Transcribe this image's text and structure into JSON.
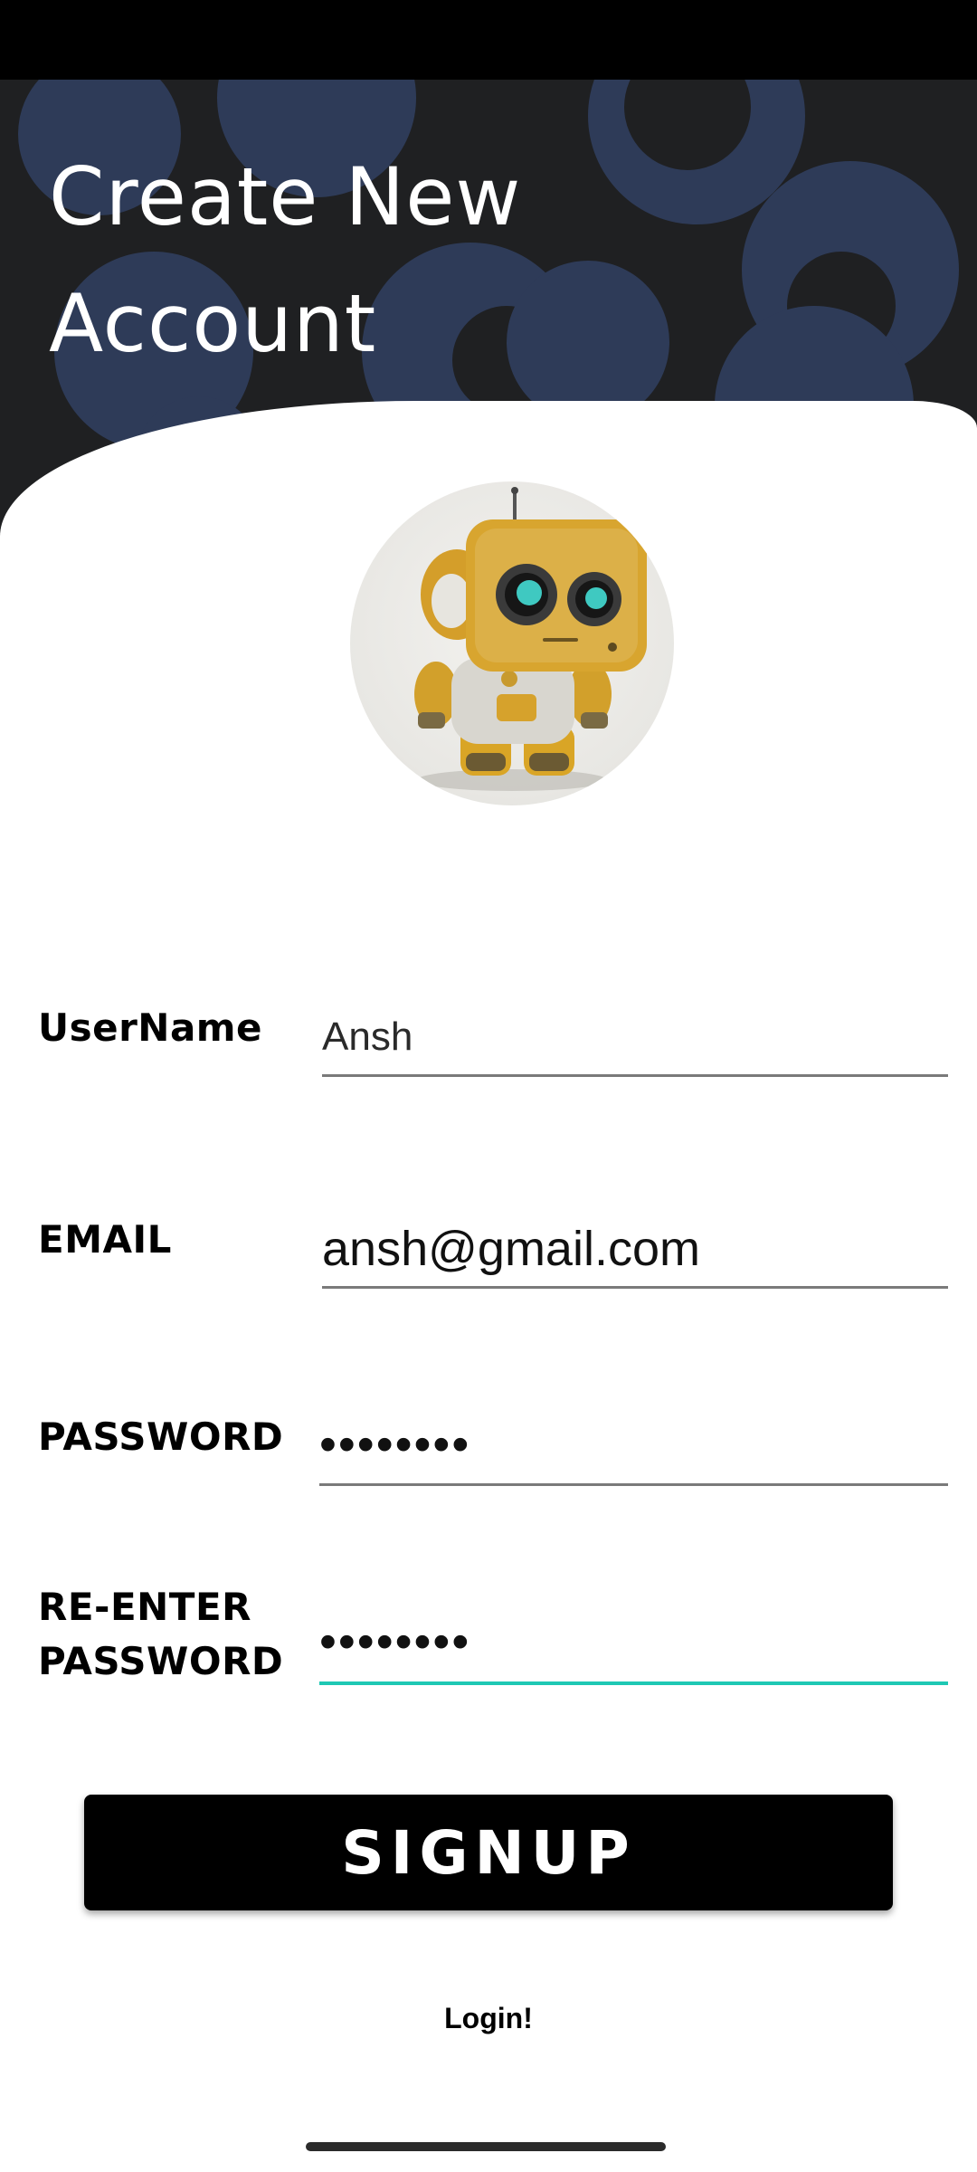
{
  "screen": {
    "title": "Create New Account"
  },
  "form": {
    "username": {
      "label": "UserName",
      "value": "Ansh"
    },
    "email": {
      "label": "EMAIL",
      "value": "ansh@gmail.com"
    },
    "password": {
      "label": "PASSWORD",
      "value": "••••••••"
    },
    "reenter_password": {
      "label_line1": "RE-ENTER",
      "label_line2": "PASSWORD",
      "value": "••••••••"
    }
  },
  "actions": {
    "signup_label": "SIGNUP",
    "login_label": "Login!"
  },
  "theme": {
    "hero_background": "#1f2022",
    "hero_circle_color": "#2e3b58",
    "active_field_underline": "#1ec8b4"
  },
  "icons": {
    "avatar": "robot-icon"
  }
}
